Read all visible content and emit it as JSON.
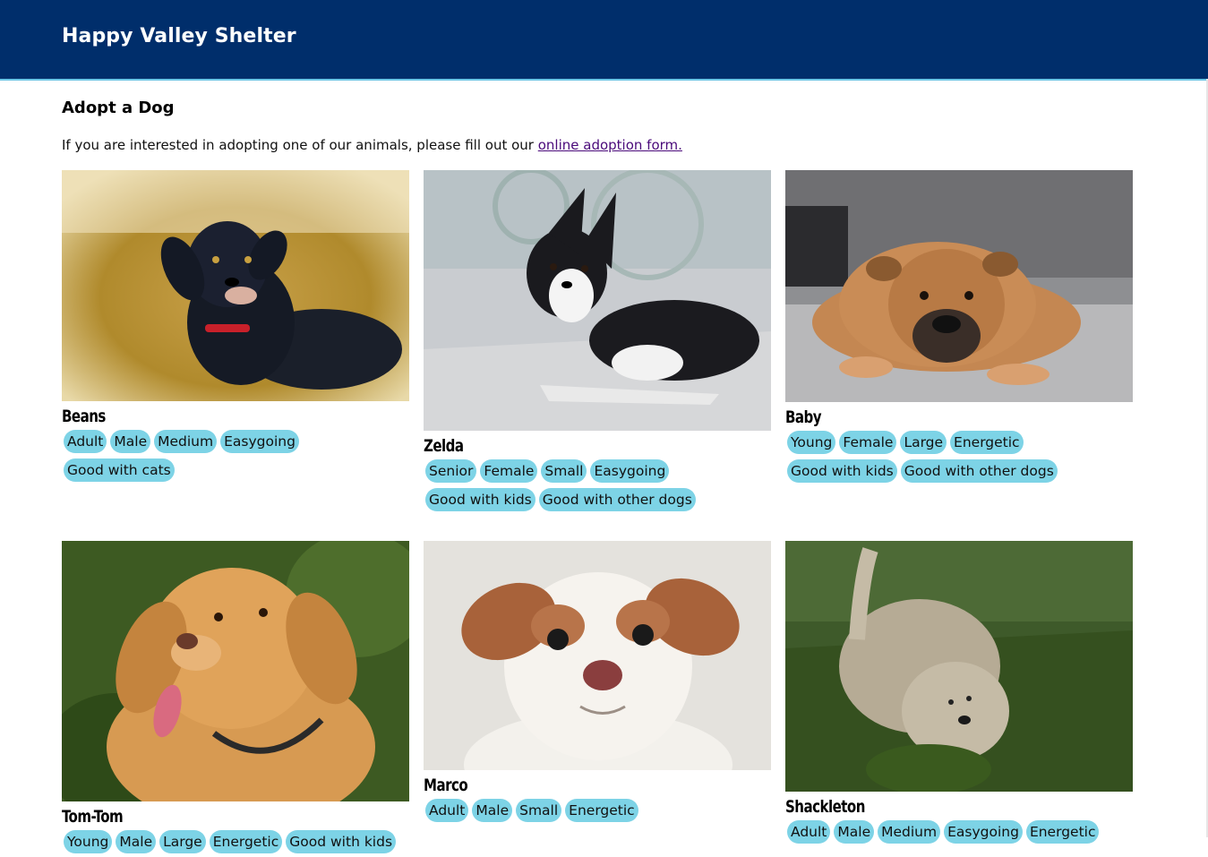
{
  "header": {
    "title": "Happy Valley Shelter"
  },
  "page": {
    "heading": "Adopt a Dog",
    "intro_text": "If you are interested in adopting one of our animals, please fill out our ",
    "intro_link": "online adoption form."
  },
  "dogs": [
    {
      "name": "Beans",
      "tags": [
        "Adult",
        "Male",
        "Medium",
        "Easygoing",
        "Good with cats"
      ]
    },
    {
      "name": "Zelda",
      "tags": [
        "Senior",
        "Female",
        "Small",
        "Easygoing",
        "Good with kids",
        "Good with other dogs"
      ]
    },
    {
      "name": "Baby",
      "tags": [
        "Young",
        "Female",
        "Large",
        "Energetic",
        "Good with kids",
        "Good with other dogs"
      ]
    },
    {
      "name": "Tom-Tom",
      "tags": [
        "Young",
        "Male",
        "Large",
        "Energetic",
        "Good with kids"
      ]
    },
    {
      "name": "Marco",
      "tags": [
        "Adult",
        "Male",
        "Small",
        "Energetic"
      ]
    },
    {
      "name": "Shackleton",
      "tags": [
        "Adult",
        "Male",
        "Medium",
        "Easygoing",
        "Energetic"
      ]
    }
  ],
  "colors": {
    "header_bg": "#002e6b",
    "header_rule": "#6cc6e6",
    "tag_bg": "#7dd3e6",
    "link": "#4a0a7a"
  }
}
